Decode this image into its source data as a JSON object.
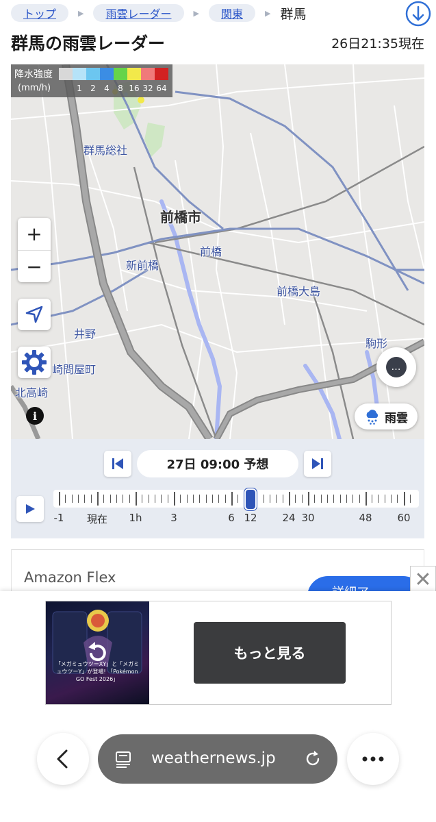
{
  "breadcrumb": {
    "items": [
      "トップ",
      "雨雲レーダー",
      "関東"
    ],
    "current": "群馬"
  },
  "header": {
    "title": "群馬の雨雲レーダー",
    "timestamp": "26日21:35現在"
  },
  "map": {
    "legend": {
      "title": "降水強度",
      "unit": "(mm/h)",
      "levels": [
        "1",
        "2",
        "4",
        "8",
        "16",
        "32",
        "64"
      ],
      "colors": [
        "#d8d8d8",
        "#b6e3f8",
        "#6cc6f0",
        "#3b8de4",
        "#66d44a",
        "#f2e94a",
        "#f07a7a",
        "#d22222"
      ]
    },
    "place_labels": {
      "gunma_soja": "群馬総社",
      "maebashi_city": "前橋市",
      "maebashi": "前橋",
      "shin_maebashi": "新前橋",
      "maebashi_oshima": "前橋大島",
      "ino": "井野",
      "sakimondoyamachi": "崎問屋町",
      "kitatakasaki": "北高崎",
      "komagata": "駒形"
    },
    "zoom_in": "+",
    "zoom_out": "−",
    "layer_label": "雨雲",
    "more_symbol": "…"
  },
  "timeline": {
    "display": "27日 09:00 予想",
    "ticks": [
      "-1",
      "現在",
      "1h",
      "3",
      "6",
      "12",
      "24",
      "30",
      "48",
      "60"
    ],
    "selected_label": "12"
  },
  "ads": {
    "card_brand": "Amazon Flex",
    "card_cta": "詳細ア",
    "close_symbol": "✕",
    "banner_cta": "もっと見る",
    "banner_fineprint": "「メガミュウツーXY」と「メガミュウツーY」が登場! 「Pokémon GO Fest 2026」"
  },
  "browser": {
    "url": "weathernews.jp"
  },
  "colors": {
    "accent": "#2f55b8",
    "link": "#2a55c8",
    "timeline_bg": "#e7ebf2",
    "map_bg": "#e9e8e6"
  }
}
